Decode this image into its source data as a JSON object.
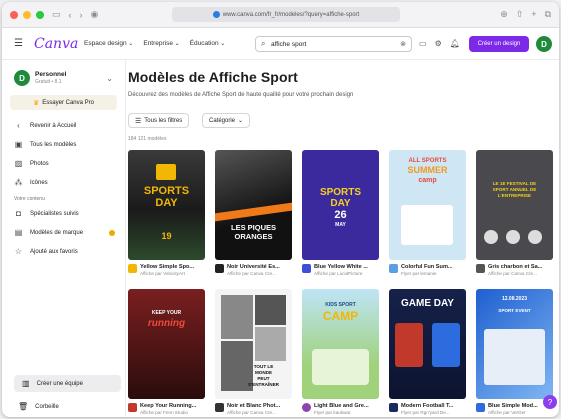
{
  "browser": {
    "url": "www.canva.com/fr_fr/modeles/?query=affiche-sport"
  },
  "header": {
    "logo": "Canva",
    "nav": [
      "Espace design",
      "Entreprise",
      "Éducation"
    ],
    "search_value": "affiche sport",
    "create_button": "Créer un design",
    "avatar_letter": "D"
  },
  "sidebar": {
    "account_name": "Personnel",
    "account_sub": "Gratuit • 8.1",
    "avatar_letter": "D",
    "pro_button": "Essayer Canva Pro",
    "back": "Revenir à Accueil",
    "items": [
      "Tous les modèles",
      "Photos",
      "Icônes"
    ],
    "section_label": "Votre contenu",
    "content_items": [
      "Spécialistes suivis",
      "Modèles de marque",
      "Ajouté aux favoris"
    ],
    "team_button": "Créer une équipe",
    "trash": "Corbeille"
  },
  "main": {
    "title": "Modèles de Affiche Sport",
    "description": "Découvrez des modèles de Affiche Sport de haute qualité pour votre prochain design",
    "filter_all": "Tous les filtres",
    "filter_category": "Catégorie",
    "count": "184 121 modèles"
  },
  "cards": [
    {
      "title": "Yellow Simple Spo...",
      "by": "Affiche par VelocityArt",
      "thumb_lines": [
        "SPORTS",
        "DAY",
        "19"
      ],
      "logo_color": "#f2b705"
    },
    {
      "title": "Noir Université Es...",
      "by": "Affiche par Canva Cre...",
      "thumb_lines": [
        "LES PIQUES",
        "ORANGES"
      ],
      "logo_color": "#222222"
    },
    {
      "title": "Blue Yellow White ...",
      "by": "Affiche par LucidPicture",
      "thumb_lines": [
        "SPORTS",
        "DAY",
        "26",
        "MAY"
      ],
      "logo_color": "#3b4fd8"
    },
    {
      "title": "Colorful Fun Sum...",
      "by": "Flyer par lemanie",
      "thumb_lines": [
        "ALL SPORTS",
        "SUMMER",
        "camp"
      ],
      "logo_color": "#5aa0e0"
    },
    {
      "title": "Gris charbon et Sa...",
      "by": "Affiche par Canva Cre...",
      "thumb_lines": [
        "LE 1E FESTIVAL DE",
        "SPORT ANNUEL DE",
        "L'ENTREPRISE"
      ],
      "logo_color": "#555555"
    },
    {
      "title": "Keep Your Running...",
      "by": "Affiche par Fenn Studio",
      "thumb_lines": [
        "KEEP YOUR",
        "running"
      ],
      "logo_color": "#c0392b"
    },
    {
      "title": "Noir et Blanc Phot...",
      "by": "Affiche par Canva Cre...",
      "thumb_lines": [
        "TOUT LE",
        "MONDE",
        "PEUT",
        "S'ENTRAÎNER"
      ],
      "logo_color": "#333333"
    },
    {
      "title": "Light Blue and Gre...",
      "by": "Flyer par kautiwat",
      "thumb_lines": [
        "KIDS SPORT",
        "CAMP"
      ],
      "logo_color": "#8e44ad"
    },
    {
      "title": "Modern Football T...",
      "by": "Flyer par Rgn'yard De...",
      "thumb_lines": [
        "GAME DAY"
      ],
      "logo_color": "#1a2a5e"
    },
    {
      "title": "Blue Simple Mod...",
      "by": "Affiche par VerGer",
      "thumb_lines": [
        "12.08.2023",
        "SPORT EVENT"
      ],
      "logo_color": "#2d6cdf"
    }
  ],
  "colors": {
    "accent": "#7d2ae8",
    "avatar": "#1f8b3a"
  }
}
